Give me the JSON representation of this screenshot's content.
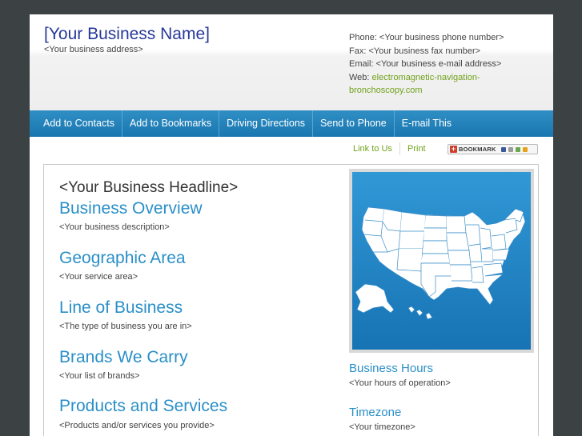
{
  "header": {
    "business_name": "[Your Business Name]",
    "business_address": "<Your business address>",
    "phone": "Phone: <Your business phone number>",
    "fax": "Fax: <Your business fax number>",
    "email": "Email: <Your business e-mail address>",
    "web_label": "Web:",
    "web_url_line1": "electromagnetic-navigation-",
    "web_url_line2": "bronchoscopy.com"
  },
  "nav": {
    "items": [
      "Add to Contacts",
      "Add to Bookmarks",
      "Driving Directions",
      "Send to Phone",
      "E-mail This"
    ]
  },
  "utility": {
    "link_to_us": "Link to Us",
    "print": "Print",
    "bookmark_label": "BOOKMARK"
  },
  "main": {
    "headline": "<Your Business Headline>",
    "sections": [
      {
        "title": "Business Overview",
        "desc": "<Your business description>"
      },
      {
        "title": "Geographic Area",
        "desc": "<Your service area>"
      },
      {
        "title": "Line of Business",
        "desc": "<The type of business you are in>"
      },
      {
        "title": "Brands We Carry",
        "desc": "<Your list of brands>"
      },
      {
        "title": "Products and Services",
        "desc": "<Products and/or services you provide>"
      }
    ]
  },
  "sidebar": {
    "hours_title": "Business Hours",
    "hours_desc": "<Your hours of operation>",
    "timezone_title": "Timezone",
    "timezone_desc": "<Your timezone>"
  },
  "colors": {
    "nav_blue": "#1f7fbb",
    "link_green": "#72a21c",
    "title_blue": "#2a8fc8",
    "name_blue": "#27389a"
  }
}
